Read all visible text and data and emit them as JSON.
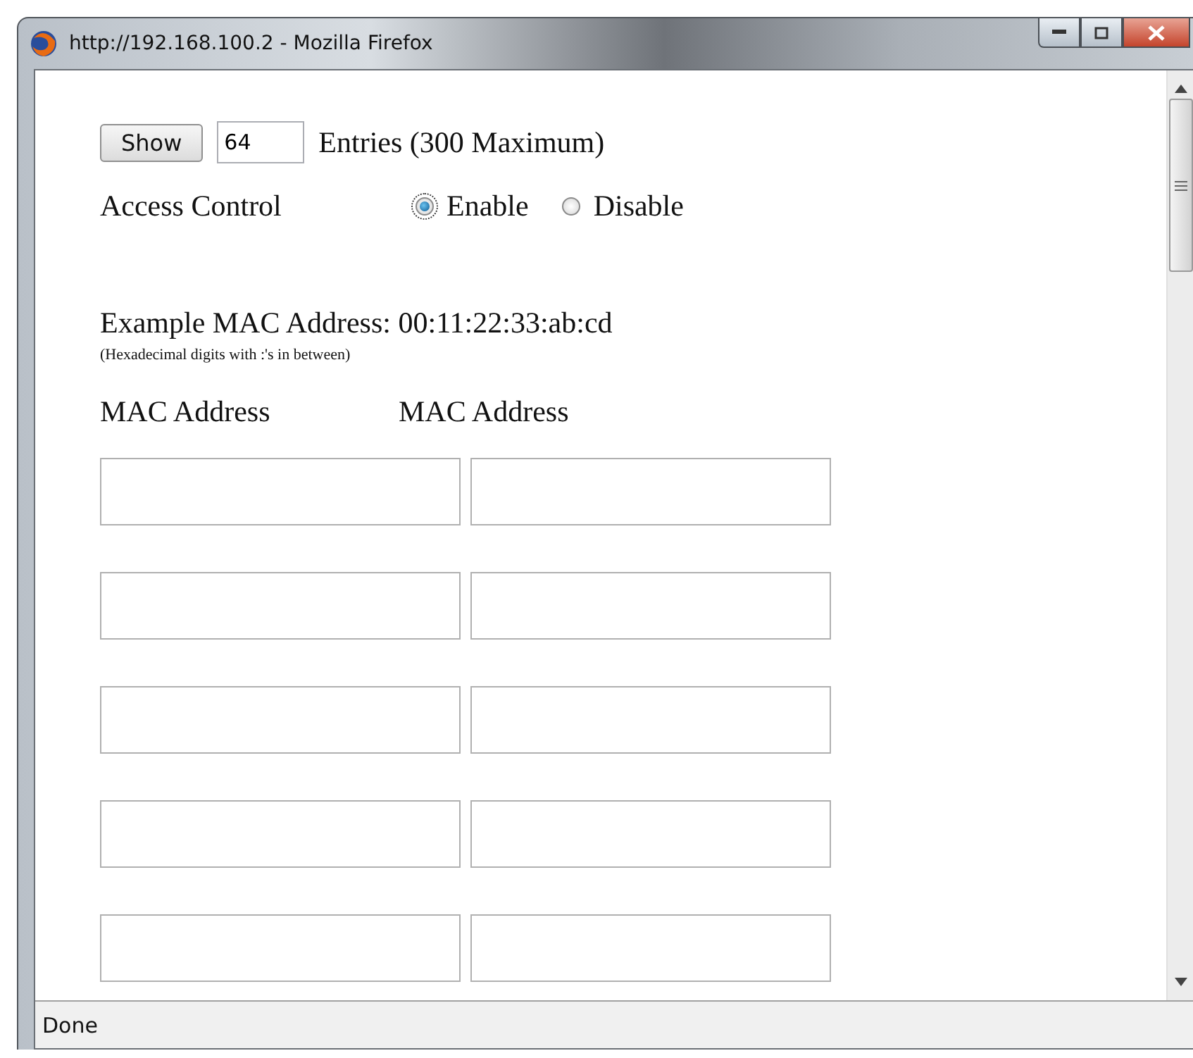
{
  "window": {
    "title": "http://192.168.100.2 - Mozilla Firefox"
  },
  "entries": {
    "button": "Show",
    "value": "64",
    "label": "Entries (300 Maximum)"
  },
  "access_control": {
    "label": "Access Control",
    "options": [
      {
        "label": "Enable",
        "selected": true
      },
      {
        "label": "Disable",
        "selected": false
      }
    ]
  },
  "example": {
    "text": "Example MAC Address: 00:11:22:33:ab:cd",
    "hint": "(Hexadecimal digits with :'s in between)"
  },
  "columns": [
    "MAC Address",
    "MAC Address"
  ],
  "mac_fields": [
    {
      "kind": "input"
    },
    {
      "kind": "input"
    },
    {
      "kind": "input"
    },
    {
      "kind": "input"
    },
    {
      "kind": "input"
    },
    {
      "kind": "input"
    },
    {
      "kind": "input"
    },
    {
      "kind": "input"
    },
    {
      "kind": "input"
    },
    {
      "kind": "input"
    }
  ],
  "status_bar": "Done"
}
